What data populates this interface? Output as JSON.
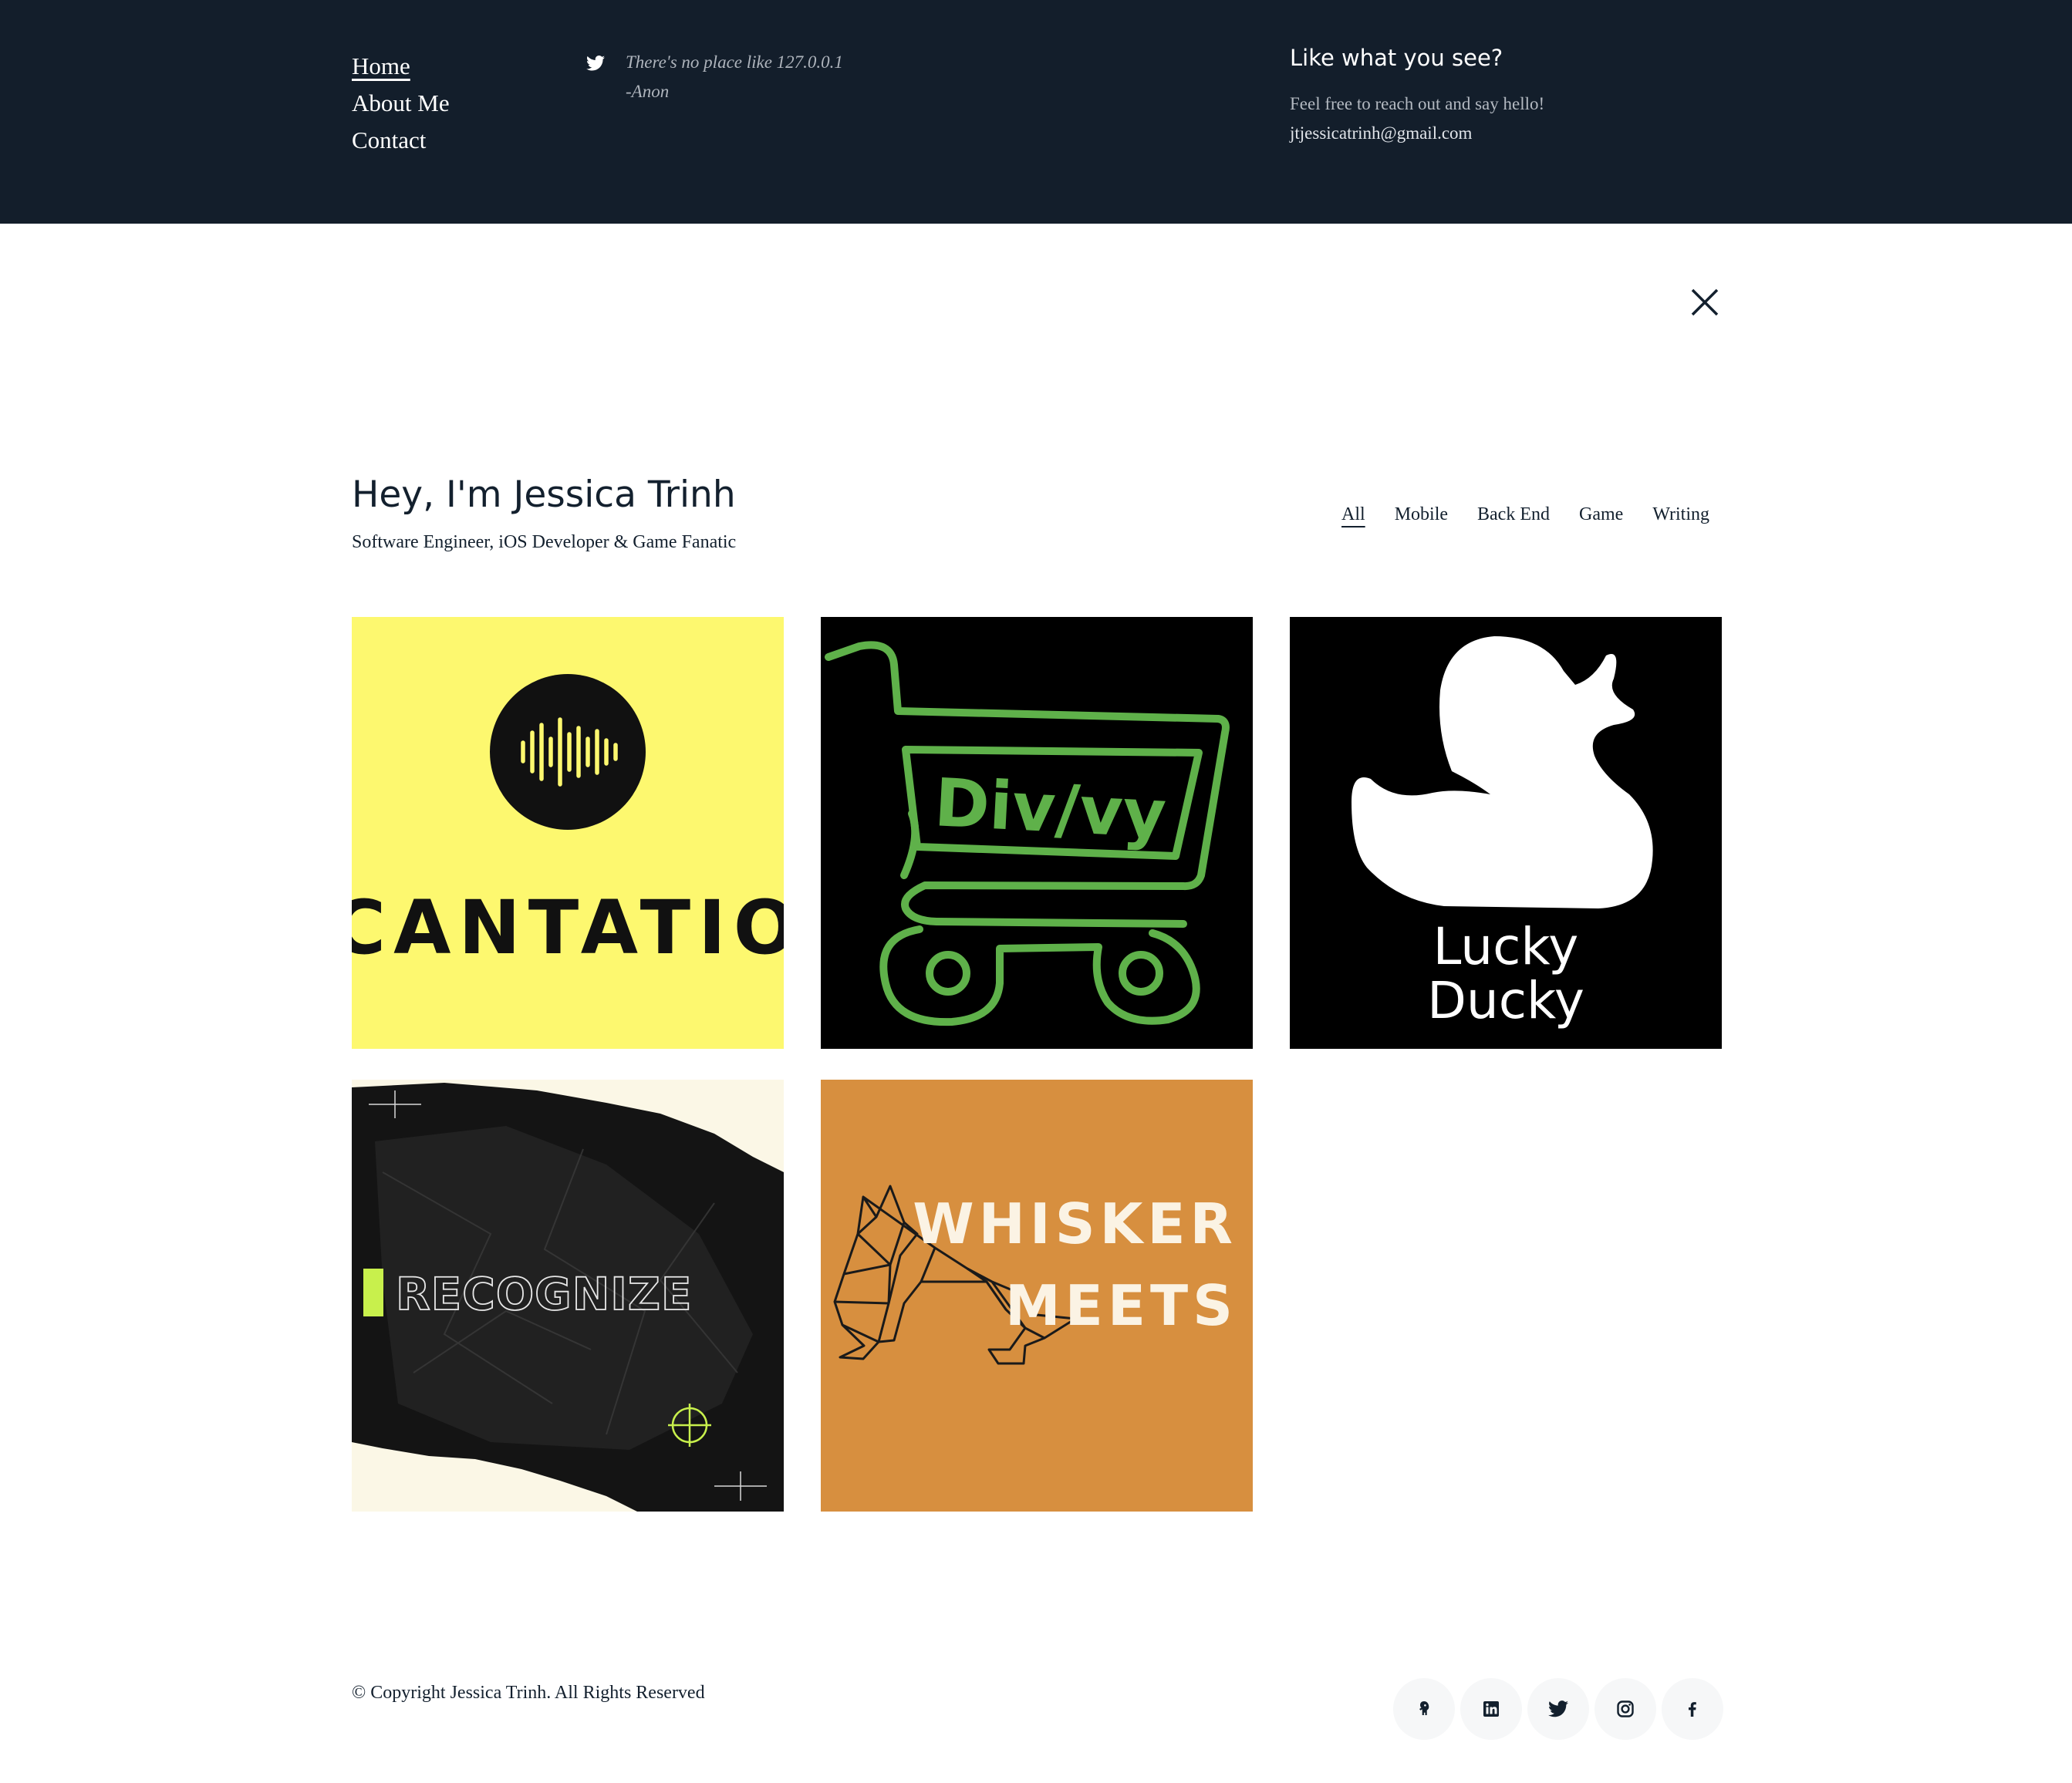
{
  "nav": {
    "items": [
      {
        "label": "Home",
        "active": true
      },
      {
        "label": "About Me",
        "active": false
      },
      {
        "label": "Contact",
        "active": false
      }
    ]
  },
  "tweet": {
    "icon": "twitter-icon",
    "quote": "There's no place like 127.0.0.1",
    "author": "-Anon"
  },
  "contact": {
    "heading": "Like what you see?",
    "text": "Feel free to reach out and say hello!",
    "email": "jtjessicatrinh@gmail.com"
  },
  "intro": {
    "title": "Hey, I'm Jessica Trinh",
    "subtitle": "Software Engineer, iOS Developer & Game Fanatic"
  },
  "filters": [
    {
      "label": "All",
      "active": true
    },
    {
      "label": "Mobile",
      "active": false
    },
    {
      "label": "Back End",
      "active": false
    },
    {
      "label": "Game",
      "active": false
    },
    {
      "label": "Writing",
      "active": false
    }
  ],
  "projects": [
    {
      "title": "CANTATIO",
      "bg": "#fdf86f"
    },
    {
      "title": "Div/vy",
      "bg": "#000000",
      "accent": "#5fb14a"
    },
    {
      "title_line1": "Lucky",
      "title_line2": "Ducky",
      "bg": "#000000"
    },
    {
      "title": "RECOGNIZE",
      "bg": "#0f0f0f",
      "accent": "#c8f04c"
    },
    {
      "title_line1": "WHISKER",
      "title_line2": "MEETS",
      "bg": "#d78f3f"
    }
  ],
  "footer": {
    "copyright": "© Copyright Jessica Trinh. All Rights Reserved",
    "socials": [
      "hackerrank-icon",
      "linkedin-icon",
      "twitter-icon",
      "instagram-icon",
      "facebook-icon"
    ]
  },
  "colors": {
    "header_bg": "#131e2b",
    "text_dark": "#13202e",
    "social_bg": "#f6f7f8"
  }
}
